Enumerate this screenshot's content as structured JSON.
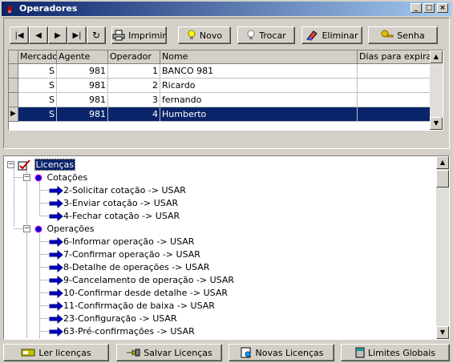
{
  "window": {
    "title": "Operadores"
  },
  "toolbar": {
    "imprimir": "Imprimir",
    "novo": "Novo",
    "trocar": "Trocar",
    "eliminar": "Eliminar",
    "senha": "Senha"
  },
  "grid": {
    "columns": [
      "Mercado",
      "Agente",
      "Operador",
      "Nome",
      "Dias para expiração"
    ],
    "rows": [
      {
        "mercado": "S",
        "agente": "981",
        "operador": "1",
        "nome": "BANCO 981"
      },
      {
        "mercado": "S",
        "agente": "981",
        "operador": "2",
        "nome": "Ricardo"
      },
      {
        "mercado": "S",
        "agente": "981",
        "operador": "3",
        "nome": "fernando"
      },
      {
        "mercado": "S",
        "agente": "981",
        "operador": "4",
        "nome": "Humberto"
      }
    ]
  },
  "tree": {
    "root": "Licenças",
    "groups": [
      {
        "label": "Cotações",
        "items": [
          "2-Solicitar cotação -> USAR",
          "3-Enviar cotação -> USAR",
          "4-Fechar cotação -> USAR"
        ]
      },
      {
        "label": "Operações",
        "items": [
          "6-Informar operação -> USAR",
          "7-Confirmar operação -> USAR",
          "8-Detalhe de operações -> USAR",
          "9-Cancelamento de operação -> USAR",
          "10-Confirmar desde detalhe -> USAR",
          "11-Confirmação de baixa -> USAR",
          "23-Configuração -> USAR",
          "63-Pré-confirmações -> USAR"
        ]
      }
    ]
  },
  "footer": {
    "ler": "Ler licenças",
    "salvar": "Salvar Licenças",
    "novas": "Novas Licenças",
    "limites": "Limites Globais"
  }
}
